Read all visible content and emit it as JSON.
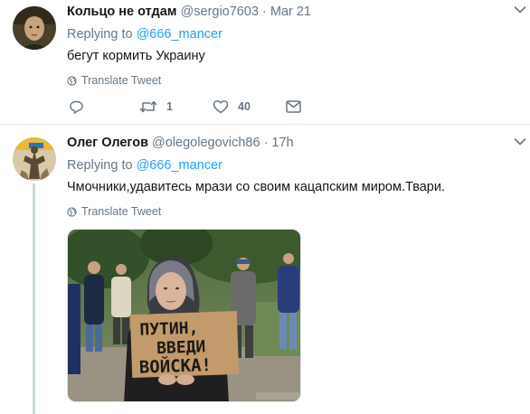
{
  "tweets": [
    {
      "fullname": "Кольцо не отдам",
      "handle": "@sergio7603",
      "separator": "·",
      "time": "Mar 21",
      "replying_prefix": "Replying to",
      "replying_handle": "@666_mancer",
      "text": "бегут кормить Украину",
      "translate": "Translate Tweet",
      "actions": {
        "reply_count": "",
        "retweet_count": "1",
        "like_count": "40"
      }
    },
    {
      "fullname": "Олег Олегов",
      "handle": "@olegolegovich86",
      "separator": "·",
      "time": "17h",
      "replying_prefix": "Replying to",
      "replying_handle": "@666_mancer",
      "text": "Чмочники,удавитесь мрази со своим кацапским миром.Твари.",
      "translate": "Translate Tweet",
      "media": {
        "sign_lines": [
          "ПУТИН,",
          "ВВЕДИ",
          "ВОЙСКА!"
        ]
      }
    }
  ],
  "colors": {
    "link": "#1da1f2",
    "secondary_text": "#657786",
    "primary_text": "#14171a",
    "divider": "#e6ecf0"
  },
  "icons": [
    "globe-icon",
    "reply-icon",
    "retweet-icon",
    "heart-icon",
    "mail-icon",
    "chevron-down-icon"
  ]
}
